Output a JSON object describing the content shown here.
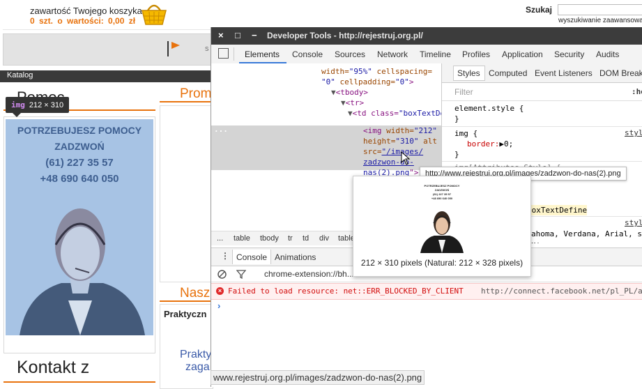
{
  "shop": {
    "cart_label": "zawartość Twojego koszyka",
    "cart_values": "0 szt.  o wartości: 0,00 zł",
    "search_label": "Szukaj",
    "adv_search": "wyszukiwanie zaawansowa",
    "bar_s": "s",
    "katalog": "Katalog",
    "pomoc_heading": "Pomoc",
    "promo_heading": "Prom",
    "nasz_heading": "Nasz",
    "prakt_bold": "Praktyczn",
    "prakt_blue_1": "Prakty",
    "prakt_blue_2": "zaga",
    "kontakt_heading": "Kontakt z",
    "accent": "#e8720c"
  },
  "help_image": {
    "lines": [
      "POTRZEBUJESZ POMOCY",
      "ZADZWOŃ",
      "(61) 227 35 57",
      "+48 690 640 050"
    ]
  },
  "tooltip": {
    "tag": "img",
    "size": "212 × 310"
  },
  "devtools": {
    "title": "Developer Tools - http://rejestruj.org.pl/",
    "window_buttons": [
      "×",
      "□",
      "−"
    ],
    "tabs": [
      "Elements",
      "Console",
      "Sources",
      "Network",
      "Timeline",
      "Profiles",
      "Application",
      "Security",
      "Audits"
    ],
    "active_tab": "Elements",
    "elements_code": {
      "l1_attr": "width=",
      "l1_val": "\"95%\"",
      "l1_attr2": " cellspacing=",
      "l2_val": "\"0\"",
      "l2_attr": " cellpadding=",
      "l2_val2": "\"0\"",
      "l2_end": ">",
      "tbody": "<tbody>",
      "tr": "<tr>",
      "td_open": "<td class=",
      "td_class": "\"boxTextDefine\"",
      "td_end": ">",
      "img_tag": "<img",
      "img_w_attr": " width=",
      "img_w_val": "\"212\"",
      "img_h_attr": "height=",
      "img_h_val": "\"310\"",
      "img_alt": " alt",
      "img_src_attr": "src=",
      "img_src_link1": "\"/images/",
      "img_src_link2": "zadzwon-do-",
      "img_src_link3": "nas(2).png",
      "img_src_end": "\">",
      "dots": "..."
    },
    "styles": {
      "sub_tabs": [
        "Styles",
        "Computed",
        "Event Listeners",
        "DOM Breakpoints"
      ],
      "filter_placeholder": "Filter",
      "hov": ":ho",
      "element_style": "element.style {",
      "close_brace": "}",
      "img_rule": "img {",
      "img_src": "style",
      "border_prop": "border:",
      "border_val": "▶0;",
      "attr_rule": "img[Attributes Style] {",
      "td_rule": "boxTextDefine",
      "font_src": "style",
      "font_val": "ahoma, Verdana, Arial, sa",
      "last_val": "x;"
    },
    "breadcrumb": [
      "...",
      "table",
      "tbody",
      "tr",
      "td",
      "div",
      "table"
    ],
    "drawer_tabs": [
      "Console",
      "Animations"
    ],
    "console_context": "chrome-extension://bh...",
    "error_text": "Failed to load resource: net::ERR_BLOCKED_BY_CLIENT",
    "error_source": "http://connect.facebook.net/pl_PL/a",
    "prompt": "›"
  },
  "url_tooltip": "http://www.rejestruj.org.pl/images/zadzwon-do-nas(2).png",
  "preview": {
    "caption": "212 × 310 pixels (Natural: 212 × 328 pixels)",
    "mini_lines": [
      "POTRZEBUJESZ POMOCY",
      "ZADZWOŃ",
      "(61) 227 35 57",
      "+48 690 640 050"
    ]
  },
  "status_bar": "www.rejestruj.org.pl/images/zadzwon-do-nas(2).png"
}
